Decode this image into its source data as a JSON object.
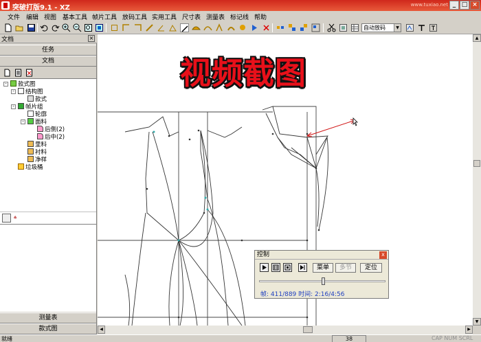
{
  "window": {
    "title": "突破打版9.1 - XZ",
    "watermark": "www.tuxiao.net",
    "buttons": {
      "minimize": "_",
      "maximize": "□",
      "close": "×"
    }
  },
  "menu": [
    "文件",
    "编辑",
    "视图",
    "基本工具",
    "帧片工具",
    "放码工具",
    "实用工具",
    "尺寸表",
    "测量表",
    "标记线",
    "帮助"
  ],
  "toolbar": {
    "icons": [
      "new-icon",
      "open-icon",
      "save-icon",
      "undo-icon",
      "redo-icon",
      "zoom-in-icon",
      "zoom-out-icon",
      "zoom-fit-icon",
      "fit-page-icon",
      "rect-tool-icon",
      "corner-tool-icon",
      "bracket-tool-icon",
      "ruler-icon",
      "angle-icon",
      "triangle-icon",
      "pen-icon",
      "arc-icon",
      "curve-icon",
      "dart-icon",
      "notch-icon",
      "pleat-icon",
      "play-icon",
      "delete-icon",
      "align-icon",
      "group-icon",
      "ungroup-icon",
      "layout-icon",
      "cut-icon",
      "grading-icon",
      "grade-table-icon",
      "piece-icon"
    ],
    "grade_select": "自动放码",
    "tail_icons": [
      "grade-view-icon",
      "text-tool-icon",
      "text-frame-icon"
    ]
  },
  "left_panel": {
    "title": "文档",
    "tabs": [
      "任务",
      "文档"
    ],
    "tree": [
      {
        "label": "款式图",
        "icon": "style-icon",
        "level": 0
      },
      {
        "label": "结构图",
        "icon": "structure-icon",
        "level": 1
      },
      {
        "label": "款式",
        "icon": "doc-icon",
        "level": 2
      },
      {
        "label": "帧片组",
        "icon": "piece-group-icon",
        "level": 1
      },
      {
        "label": "轮廓",
        "icon": "outline-icon",
        "level": 2
      },
      {
        "label": "面料",
        "icon": "fabric-icon",
        "level": 2
      },
      {
        "label": "后侧(2)",
        "icon": "piece-icon",
        "level": 3
      },
      {
        "label": "后中(2)",
        "icon": "piece-icon",
        "level": 3
      },
      {
        "label": "里料",
        "icon": "lining-icon",
        "level": 2
      },
      {
        "label": "衬料",
        "icon": "interlining-icon",
        "level": 2
      },
      {
        "label": "净样",
        "icon": "net-icon",
        "level": 2
      },
      {
        "label": "垃圾桶",
        "icon": "trash-icon",
        "level": 1
      }
    ],
    "bottom_tabs": [
      "测量表",
      "款式图"
    ]
  },
  "canvas": {
    "overlay_title": "视频截图"
  },
  "control_dialog": {
    "title": "控制",
    "close": "x",
    "playback_icons": [
      "play-icon",
      "pause-icon",
      "stop-icon",
      "step-icon"
    ],
    "buttons": {
      "menu": "菜单",
      "multi": "多节",
      "locate": "定位"
    },
    "slider_position": 0.51,
    "info": "帧: 411/889 时间: 2:16/4:56"
  },
  "statusbar": {
    "ready": "就绪",
    "number": "38",
    "keys": "CAP NUM SCRL"
  }
}
